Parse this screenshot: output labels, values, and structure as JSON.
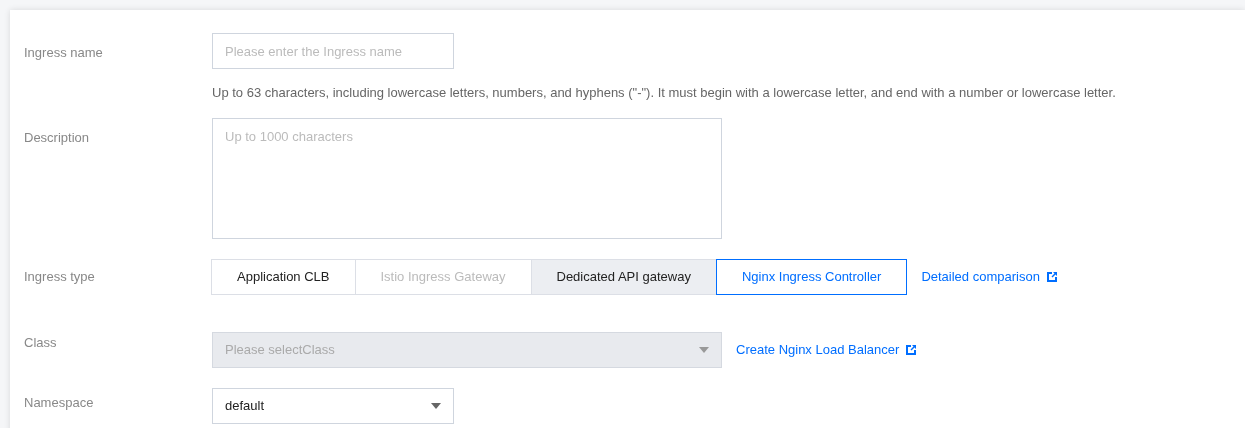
{
  "fields": [
    {
      "kind": "input",
      "label": "Ingress name",
      "placeholder": "Please enter the Ingress name",
      "hint": "Up to 63 characters, including lowercase letters, numbers, and hyphens (\"-\"). It must begin with a lowercase letter, and end with a number or lowercase letter."
    },
    {
      "kind": "textarea",
      "label": "Description",
      "placeholder": "Up to 1000 characters"
    },
    {
      "kind": "segmented",
      "label": "Ingress type",
      "options": [
        {
          "label": "Application CLB",
          "selected": false,
          "disabled": false,
          "highlighted": false
        },
        {
          "label": "Istio Ingress Gateway",
          "selected": false,
          "disabled": true,
          "highlighted": false
        },
        {
          "label": "Dedicated API gateway",
          "selected": false,
          "disabled": false,
          "highlighted": true
        },
        {
          "label": "Nginx Ingress Controller",
          "selected": true,
          "disabled": false,
          "highlighted": false
        }
      ],
      "link": "Detailed comparison"
    },
    {
      "kind": "select",
      "label": "Class",
      "placeholder": "Please selectClass",
      "disabled": true,
      "wide": true,
      "link": "Create Nginx Load Balancer"
    },
    {
      "kind": "select",
      "label": "Namespace",
      "value": "default",
      "disabled": false,
      "wide": false
    }
  ]
}
